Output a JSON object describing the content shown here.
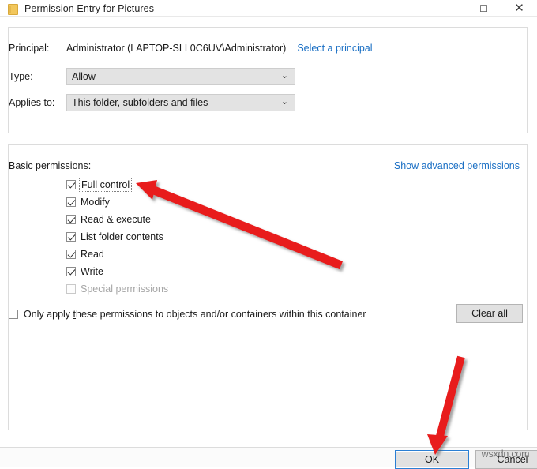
{
  "window": {
    "title": "Permission Entry for Pictures",
    "icon": "folder-icon",
    "controls": {
      "minimize": "–",
      "maximize": "☐",
      "close": "✕"
    }
  },
  "principal_section": {
    "principal_label": "Principal:",
    "principal_value": "Administrator (LAPTOP-SLL0C6UV\\Administrator)",
    "select_principal_link": "Select a principal",
    "type_label": "Type:",
    "type_value": "Allow",
    "applies_to_label": "Applies to:",
    "applies_to_value": "This folder, subfolders and files",
    "chevron": "⌄"
  },
  "permissions_section": {
    "heading": "Basic permissions:",
    "advanced_link": "Show advanced permissions",
    "items": [
      {
        "label": "Full control",
        "checked": true,
        "disabled": false,
        "focused": true
      },
      {
        "label": "Modify",
        "checked": true,
        "disabled": false,
        "focused": false
      },
      {
        "label": "Read & execute",
        "checked": true,
        "disabled": false,
        "focused": false
      },
      {
        "label": "List folder contents",
        "checked": true,
        "disabled": false,
        "focused": false
      },
      {
        "label": "Read",
        "checked": true,
        "disabled": false,
        "focused": false
      },
      {
        "label": "Write",
        "checked": true,
        "disabled": false,
        "focused": false
      },
      {
        "label": "Special permissions",
        "checked": false,
        "disabled": true,
        "focused": false
      }
    ],
    "only_apply": {
      "label_before": "Only apply ",
      "accel": "t",
      "label_after": "hese permissions to objects and/or containers within this container",
      "full_label": "Only apply these permissions to objects and/or containers within this container",
      "checked": false
    },
    "clear_all_label": "Clear all"
  },
  "footer": {
    "ok_label": "OK",
    "cancel_label": "Cancel",
    "watermark": "wsxdn.com"
  },
  "annotations": {
    "arrow_color": "#e81b1b",
    "arrow_1_target": "full-control-checkbox",
    "arrow_2_target": "ok-button"
  }
}
